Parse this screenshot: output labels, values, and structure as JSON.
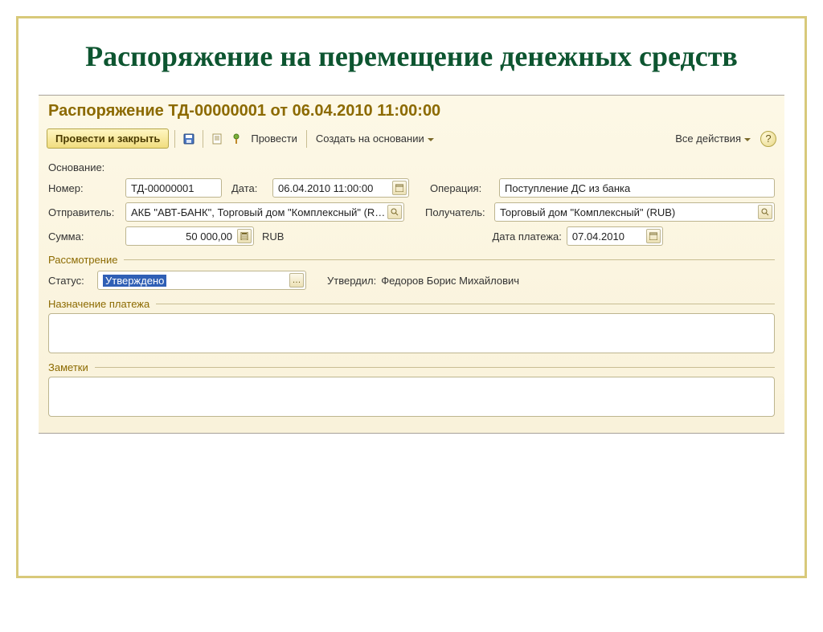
{
  "page_title": "Распоряжение на перемещение денежных средств",
  "window_header": "Распоряжение ТД-00000001 от 06.04.2010 11:00:00",
  "toolbar": {
    "submit_close": "Провести и закрыть",
    "submit": "Провести",
    "create_based": "Создать на основании",
    "all_actions": "Все действия",
    "help": "?"
  },
  "labels": {
    "basis": "Основание:",
    "number": "Номер:",
    "date": "Дата:",
    "operation": "Операция:",
    "sender": "Отправитель:",
    "recipient": "Получатель:",
    "amount": "Сумма:",
    "currency": "RUB",
    "payment_date": "Дата платежа:",
    "review": "Рассмотрение",
    "status": "Статус:",
    "approved_by": "Утвердил:",
    "payment_purpose": "Назначение платежа",
    "notes": "Заметки"
  },
  "values": {
    "number": "ТД-00000001",
    "date": "06.04.2010 11:00:00",
    "operation": "Поступление ДС из банка",
    "sender": "АКБ \"АВТ-БАНК\", Торговый дом \"Комплексный\" (RU…",
    "recipient": "Торговый дом \"Комплексный\" (RUB)",
    "amount": "50 000,00",
    "payment_date": "07.04.2010",
    "status": "Утверждено",
    "approved_by": "Федоров Борис Михайлович"
  }
}
